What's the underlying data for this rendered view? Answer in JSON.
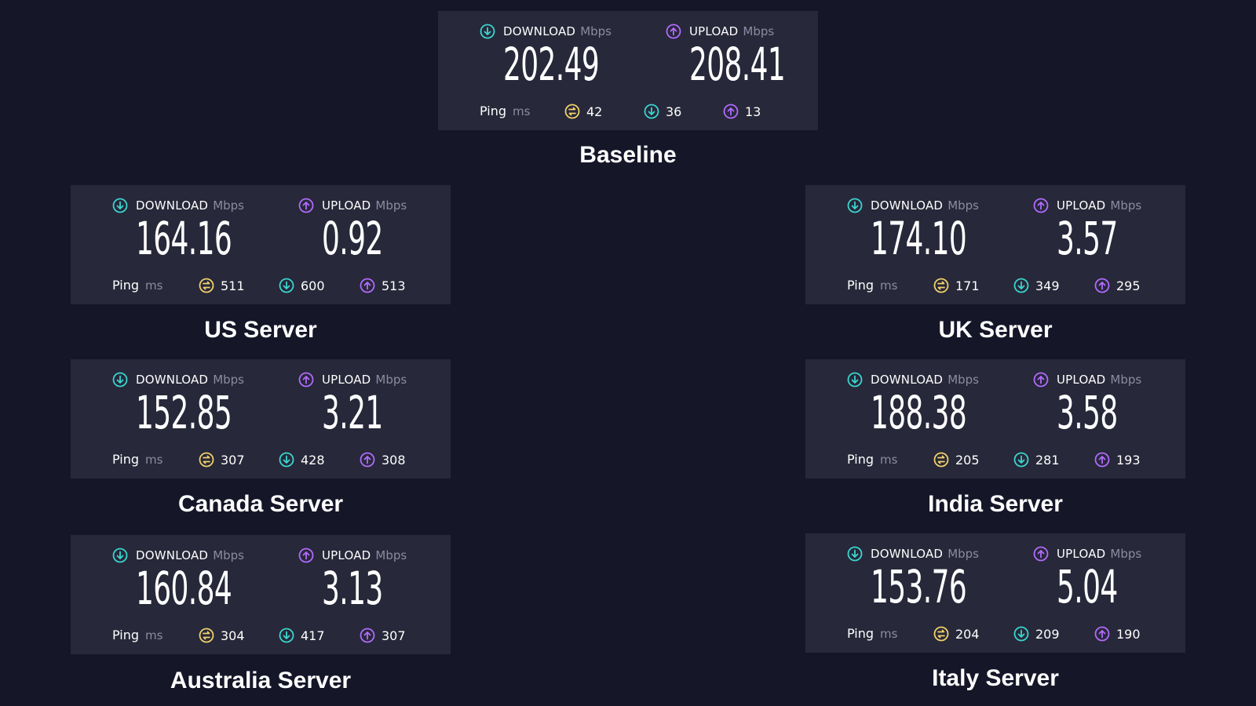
{
  "labels": {
    "download": "DOWNLOAD",
    "upload": "UPLOAD",
    "mbps": "Mbps",
    "ping": "Ping",
    "ms": "ms"
  },
  "colors": {
    "background": "#151628",
    "card": "#272839",
    "download_icon": "#3ad6d0",
    "upload_icon": "#b26bff",
    "ping_icon": "#f2d26a"
  },
  "icons": {
    "download": "download-arrow-icon",
    "upload": "upload-arrow-icon",
    "ping": "ping-idle-icon"
  },
  "tests": [
    {
      "name": "Baseline",
      "download": "202.49",
      "upload": "208.41",
      "ping_idle": "42",
      "ping_down": "36",
      "ping_up": "13"
    },
    {
      "name": "US Server",
      "download": "164.16",
      "upload": "0.92",
      "ping_idle": "511",
      "ping_down": "600",
      "ping_up": "513"
    },
    {
      "name": "UK Server",
      "download": "174.10",
      "upload": "3.57",
      "ping_idle": "171",
      "ping_down": "349",
      "ping_up": "295"
    },
    {
      "name": "Canada Server",
      "download": "152.85",
      "upload": "3.21",
      "ping_idle": "307",
      "ping_down": "428",
      "ping_up": "308"
    },
    {
      "name": "India Server",
      "download": "188.38",
      "upload": "3.58",
      "ping_idle": "205",
      "ping_down": "281",
      "ping_up": "193"
    },
    {
      "name": "Australia Server",
      "download": "160.84",
      "upload": "3.13",
      "ping_idle": "304",
      "ping_down": "417",
      "ping_up": "307"
    },
    {
      "name": "Italy Server",
      "download": "153.76",
      "upload": "5.04",
      "ping_idle": "204",
      "ping_down": "209",
      "ping_up": "190"
    }
  ]
}
